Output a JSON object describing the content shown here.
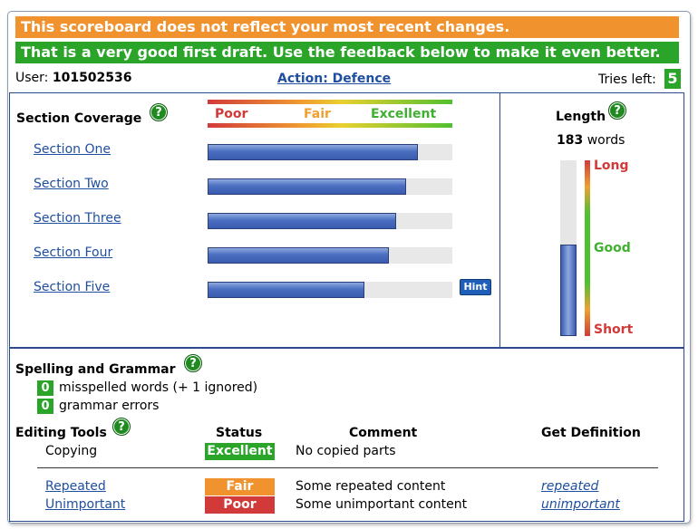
{
  "banners": {
    "warning": "This scoreboard does not reflect your most recent changes.",
    "feedback": "That is a very good first draft. Use the feedback below to make it even better."
  },
  "user": {
    "label": "User:",
    "id": "101502536"
  },
  "action": "Action: Defence",
  "tries": {
    "label": "Tries left:",
    "count": "5"
  },
  "coverage": {
    "title": "Section Coverage",
    "scale": {
      "poor": "Poor",
      "fair": "Fair",
      "excellent": "Excellent"
    },
    "sections": [
      {
        "label": "Section One",
        "level": 0.86
      },
      {
        "label": "Section Two",
        "level": 0.81
      },
      {
        "label": "Section Three",
        "level": 0.77
      },
      {
        "label": "Section Four",
        "level": 0.74
      },
      {
        "label": "Section Five",
        "level": 0.64
      }
    ],
    "hint": "Hint"
  },
  "length": {
    "title": "Length",
    "count": "183",
    "unit": "words",
    "level": 0.52,
    "labels": {
      "long": "Long",
      "good": "Good",
      "short": "Short"
    }
  },
  "spelling": {
    "title": "Spelling and Grammar",
    "misspelled_count": "0",
    "misspelled_text": "misspelled words (+ 1 ignored)",
    "grammar_count": "0",
    "grammar_text": "grammar errors"
  },
  "editing": {
    "title": "Editing Tools",
    "headers": {
      "status": "Status",
      "comment": "Comment",
      "definition": "Get Definition"
    },
    "rows": [
      {
        "tool": "Copying",
        "status": "Excellent",
        "comment": "No copied parts",
        "definition": ""
      },
      {
        "tool": "Repeated",
        "status": "Fair",
        "comment": "Some repeated content",
        "definition": "repeated"
      },
      {
        "tool": "Unimportant",
        "status": "Poor",
        "comment": "Some unimportant content",
        "definition": "unimportant"
      }
    ]
  },
  "help_glyph": "?",
  "colors": {
    "accent_green": "#2aa52a",
    "accent_orange": "#f0932f",
    "accent_red": "#d23a3a",
    "link_blue": "#1f4fa0"
  }
}
